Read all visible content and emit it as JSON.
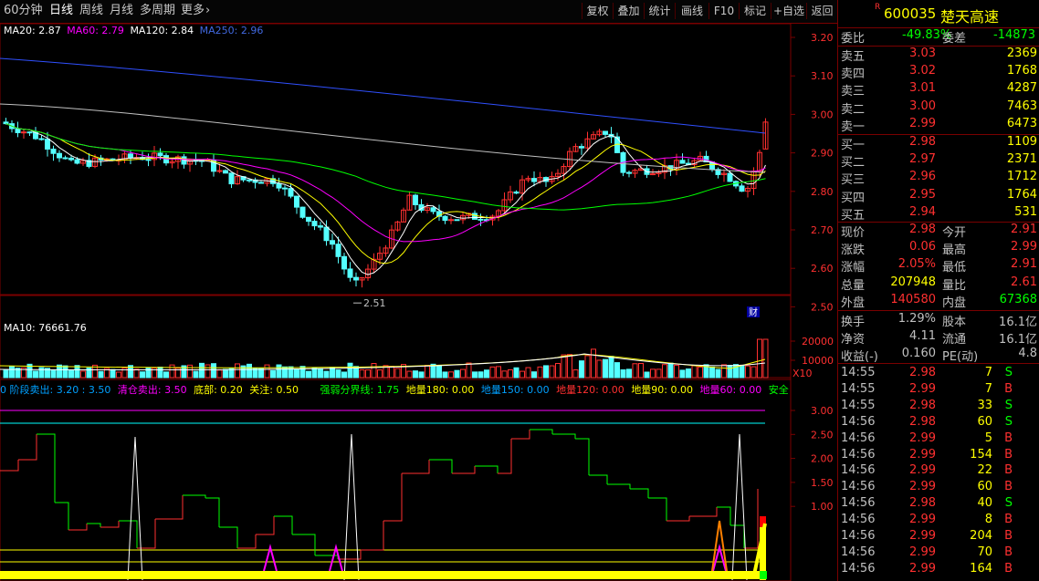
{
  "toolbar": {
    "period_tabs": [
      "60分钟",
      "日线",
      "周线",
      "月线",
      "多周期",
      "更多"
    ],
    "active_tab": "日线",
    "more_arrow": "›",
    "buttons": [
      "复权",
      "叠加",
      "统计",
      "画线",
      "F10",
      "标记",
      "+自选",
      "返回"
    ]
  },
  "main_chart": {
    "indicators": [
      {
        "label": "MA20: 2.87",
        "color": "#ffffff"
      },
      {
        "label": "MA60: 2.79",
        "color": "#ff00ff"
      },
      {
        "label": "MA120: 2.84",
        "color": "#ffffff"
      },
      {
        "label": "MA250: 2.96",
        "color": "#4169e1"
      }
    ],
    "price_axis": [
      "3.20",
      "3.10",
      "3.00",
      "2.90",
      "2.80",
      "2.70",
      "2.60",
      "2.50"
    ],
    "low_marker": "2.51",
    "badge": "财"
  },
  "volume_chart": {
    "label": "MA10: 76661.76",
    "axis": [
      "20000",
      "10000"
    ],
    "unit": "X10"
  },
  "sub_chart": {
    "labels": [
      {
        "text": "0 阶段卖出: 3.20 : 3.50",
        "color": "#00a0ff"
      },
      {
        "text": "清仓卖出: 3.50",
        "color": "#ff00ff"
      },
      {
        "text": "底部: 0.20",
        "color": "#ffff00"
      },
      {
        "text": "关注: 0.50",
        "color": "#ffff00"
      },
      {
        "text": "强弱分界线: 1.75",
        "color": "#00ff00"
      },
      {
        "text": "地量180: 0.00",
        "color": "#ffff00"
      },
      {
        "text": "地量150: 0.00",
        "color": "#00a0ff"
      },
      {
        "text": "地量120: 0.00",
        "color": "#ff3030"
      },
      {
        "text": "地量90: 0.00",
        "color": "#ffff00"
      },
      {
        "text": "地量60: 0.00",
        "color": "#ff00ff"
      },
      {
        "text": "安全",
        "color": "#00ff00"
      }
    ],
    "axis": [
      "3.00",
      "2.50",
      "2.00",
      "1.50",
      "1.00"
    ]
  },
  "quote": {
    "r_mark": "R",
    "code": "600035",
    "name": "楚天高速",
    "ratio_label": "委比",
    "ratio_value": "-49.83%",
    "diff_label": "委差",
    "diff_value": "-14873",
    "sells": [
      {
        "label": "卖五",
        "price": "3.03",
        "vol": "2369"
      },
      {
        "label": "卖四",
        "price": "3.02",
        "vol": "1768"
      },
      {
        "label": "卖三",
        "price": "3.01",
        "vol": "4287"
      },
      {
        "label": "卖二",
        "price": "3.00",
        "vol": "7463"
      },
      {
        "label": "卖一",
        "price": "2.99",
        "vol": "6473"
      }
    ],
    "buys": [
      {
        "label": "买一",
        "price": "2.98",
        "vol": "1109"
      },
      {
        "label": "买二",
        "price": "2.97",
        "vol": "2371"
      },
      {
        "label": "买三",
        "price": "2.96",
        "vol": "1712"
      },
      {
        "label": "买四",
        "price": "2.95",
        "vol": "1764"
      },
      {
        "label": "买五",
        "price": "2.94",
        "vol": "531"
      }
    ],
    "stats": [
      {
        "l1": "现价",
        "v1": "2.98",
        "c1": "#ff3030",
        "l2": "今开",
        "v2": "2.91",
        "c2": "#ff3030"
      },
      {
        "l1": "涨跌",
        "v1": "0.06",
        "c1": "#ff3030",
        "l2": "最高",
        "v2": "2.99",
        "c2": "#ff3030"
      },
      {
        "l1": "涨幅",
        "v1": "2.05%",
        "c1": "#ff3030",
        "l2": "最低",
        "v2": "2.91",
        "c2": "#ff3030"
      },
      {
        "l1": "总量",
        "v1": "207948",
        "c1": "#ffff00",
        "l2": "量比",
        "v2": "2.61",
        "c2": "#ff3030"
      },
      {
        "l1": "外盘",
        "v1": "140580",
        "c1": "#ff3030",
        "l2": "内盘",
        "v2": "67368",
        "c2": "#00ff00"
      }
    ],
    "stats2": [
      {
        "l1": "换手",
        "v1": "1.29%",
        "l2": "股本",
        "v2": "16.1亿"
      },
      {
        "l1": "净资",
        "v1": "4.11",
        "l2": "流通",
        "v2": "16.1亿"
      },
      {
        "l1": "收益(-)",
        "v1": "0.160",
        "l2": "PE(动)",
        "v2": "4.8"
      }
    ],
    "ticks": [
      {
        "time": "14:55",
        "price": "2.98",
        "vol": "7",
        "side": "S"
      },
      {
        "time": "14:55",
        "price": "2.99",
        "vol": "7",
        "side": "B"
      },
      {
        "time": "14:55",
        "price": "2.98",
        "vol": "33",
        "side": "S"
      },
      {
        "time": "14:56",
        "price": "2.98",
        "vol": "60",
        "side": "S"
      },
      {
        "time": "14:56",
        "price": "2.99",
        "vol": "5",
        "side": "B"
      },
      {
        "time": "14:56",
        "price": "2.99",
        "vol": "154",
        "side": "B"
      },
      {
        "time": "14:56",
        "price": "2.99",
        "vol": "22",
        "side": "B"
      },
      {
        "time": "14:56",
        "price": "2.99",
        "vol": "60",
        "side": "B"
      },
      {
        "time": "14:56",
        "price": "2.98",
        "vol": "40",
        "side": "S"
      },
      {
        "time": "14:56",
        "price": "2.99",
        "vol": "8",
        "side": "B"
      },
      {
        "time": "14:56",
        "price": "2.99",
        "vol": "204",
        "side": "B"
      },
      {
        "time": "14:56",
        "price": "2.99",
        "vol": "70",
        "side": "B"
      },
      {
        "time": "14:56",
        "price": "2.99",
        "vol": "164",
        "side": "B"
      }
    ]
  },
  "colors": {
    "up": "#ff3030",
    "down": "#54ffff",
    "grid": "#7a0000",
    "bg": "#000000"
  }
}
